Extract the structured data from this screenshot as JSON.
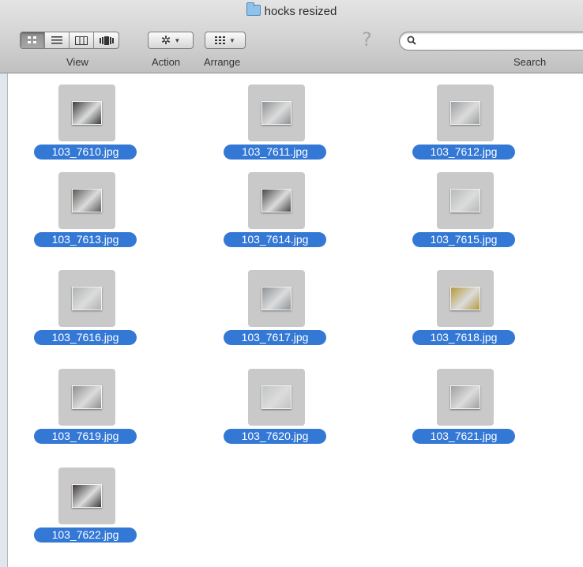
{
  "window": {
    "title": "hocks resized"
  },
  "toolbar": {
    "view_label": "View",
    "action_label": "Action",
    "arrange_label": "Arrange",
    "search_label": "Search",
    "search_placeholder": "",
    "view_modes": [
      "icon",
      "list",
      "columns",
      "cover-flow"
    ],
    "selected_view": "icon"
  },
  "files": [
    {
      "name": "103_7610.jpg",
      "selected": true,
      "color": "#3b3e3d"
    },
    {
      "name": "103_7611.jpg",
      "selected": true,
      "color": "#8d9296"
    },
    {
      "name": "103_7612.jpg",
      "selected": true,
      "color": "#9ca0a2"
    },
    {
      "name": "103_7613.jpg",
      "selected": true,
      "color": "#5d5c5a"
    },
    {
      "name": "103_7614.jpg",
      "selected": true,
      "color": "#4a4a4c"
    },
    {
      "name": "103_7615.jpg",
      "selected": true,
      "color": "#b7b9ba"
    },
    {
      "name": "103_7616.jpg",
      "selected": true,
      "color": "#b0b2b2"
    },
    {
      "name": "103_7617.jpg",
      "selected": true,
      "color": "#8e9499"
    },
    {
      "name": "103_7618.jpg",
      "selected": true,
      "color": "#b59a3e"
    },
    {
      "name": "103_7619.jpg",
      "selected": true,
      "color": "#8f8f8d"
    },
    {
      "name": "103_7620.jpg",
      "selected": true,
      "color": "#c2c4c4"
    },
    {
      "name": "103_7621.jpg",
      "selected": true,
      "color": "#9fa0a0"
    },
    {
      "name": "103_7622.jpg",
      "selected": true,
      "color": "#3e3a38"
    }
  ],
  "colors": {
    "selection": "#3478d6",
    "toolbar": "#d2d2d2",
    "thumb_bg": "#c9c9c9"
  }
}
